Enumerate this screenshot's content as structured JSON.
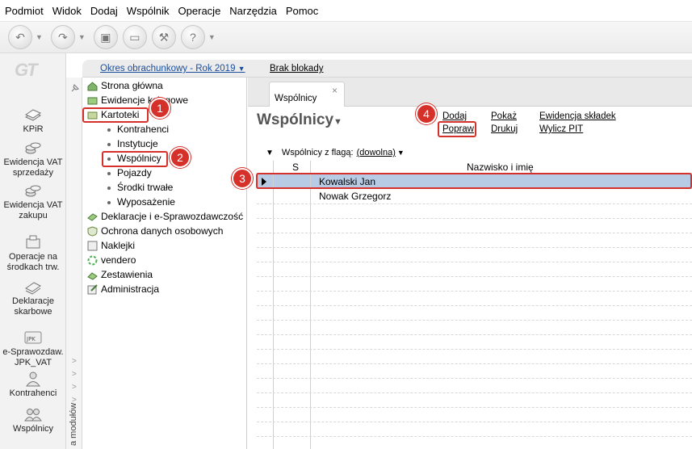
{
  "menu": [
    "Podmiot",
    "Widok",
    "Dodaj",
    "Wspólnik",
    "Operacje",
    "Narzędzia",
    "Pomoc"
  ],
  "toolbar": {
    "icons": [
      "back-icon",
      "forward-icon",
      "stamp-icon",
      "eraser-icon",
      "tools-icon",
      "help-icon"
    ]
  },
  "modules": [
    {
      "label": "KPiR",
      "icon": "book-icon"
    },
    {
      "label": "Ewidencja VAT sprzedaży",
      "icon": "coins-icon"
    },
    {
      "label": "Ewidencja VAT zakupu",
      "icon": "coins-icon"
    },
    {
      "label": "Operacje na środkach trw.",
      "icon": "assets-icon"
    },
    {
      "label": "Deklaracje skarbowe",
      "icon": "declaration-icon"
    },
    {
      "label": "e-Sprawozdaw. JPK_VAT",
      "icon": "jpk-icon"
    },
    {
      "label": "Kontrahenci",
      "icon": "person-icon"
    },
    {
      "label": "Wspólnicy",
      "icon": "partners-icon"
    }
  ],
  "modules_strip_label": "a modułów",
  "info": {
    "period": "Okres obrachunkowy - Rok 2019",
    "lock": "Brak blokady"
  },
  "tree": {
    "items": [
      {
        "label": "Strona główna"
      },
      {
        "label": "Ewidencje księgowe"
      },
      {
        "label": "Kartoteki"
      },
      {
        "label": "Deklaracje i e-Sprawozdawczość"
      },
      {
        "label": "Ochrona danych osobowych"
      },
      {
        "label": "Naklejki"
      },
      {
        "label": "vendero"
      },
      {
        "label": "Zestawienia"
      },
      {
        "label": "Administracja"
      }
    ],
    "sub": [
      "Kontrahenci",
      "Instytucje",
      "Wspólnicy",
      "Pojazdy",
      "Środki trwałe",
      "Wyposażenie"
    ]
  },
  "tab": {
    "label": "Wspólnicy",
    "close": "×"
  },
  "page": {
    "title": "Wspólnicy",
    "actions": {
      "dodaj": "Dodaj",
      "popraw": "Popraw",
      "pokaz": "Pokaż",
      "drukuj": "Drukuj",
      "ewidencja": "Ewidencja składek",
      "wylicz": "Wylicz PIT"
    },
    "filter_label": "Wspólnicy z flagą:",
    "filter_value": "(dowolna)"
  },
  "grid": {
    "columns": [
      "S",
      "Nazwisko i imię"
    ],
    "rows": [
      {
        "name": "Kowalski Jan"
      },
      {
        "name": "Nowak Grzegorz"
      }
    ]
  },
  "callouts": [
    "1",
    "2",
    "3",
    "4"
  ],
  "colors": {
    "accent": "#d6302a",
    "selection": "#b7cbe5",
    "link": "#1a4fa0"
  }
}
